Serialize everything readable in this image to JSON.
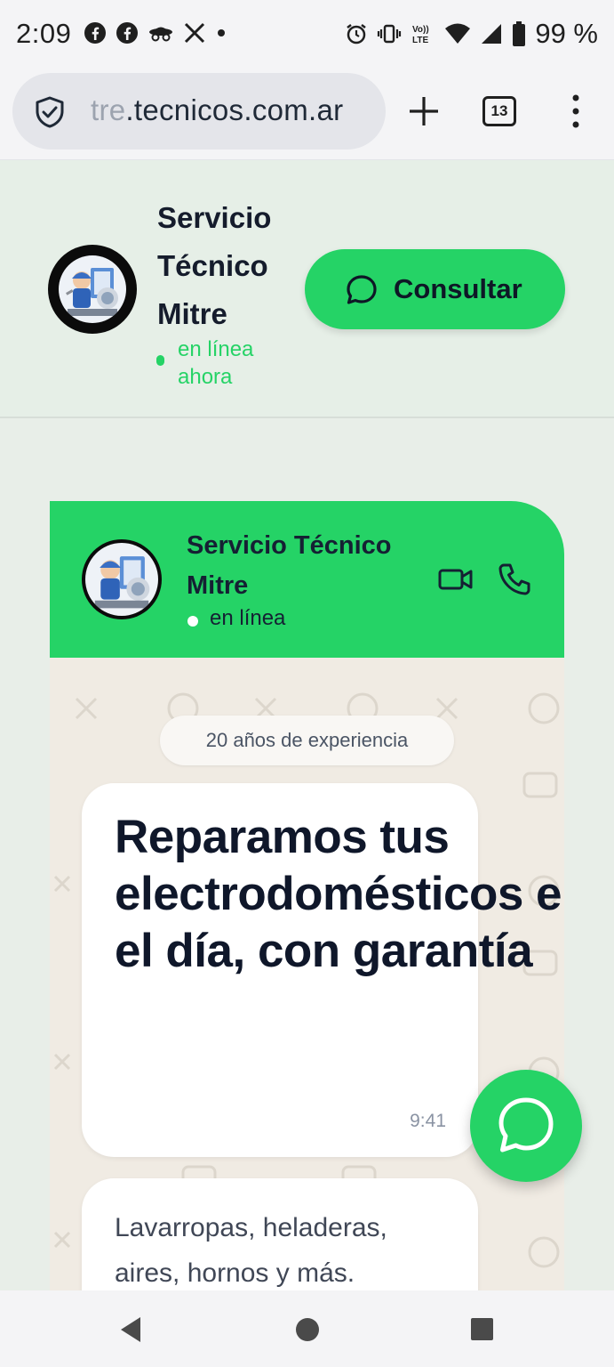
{
  "status_bar": {
    "time": "2:09",
    "battery_percent": "99 %",
    "icons_left": [
      "facebook-icon",
      "facebook-icon",
      "incognito-icon",
      "x-icon",
      "dot-icon"
    ],
    "icons_right": [
      "alarm-icon",
      "vibrate-icon",
      "volte-icon",
      "wifi-icon",
      "signal-icon",
      "battery-icon"
    ]
  },
  "browser": {
    "url_faded": "tre",
    "url_main": ".tecnicos.com.ar",
    "tab_count": "13"
  },
  "header": {
    "brand": "Servicio Técnico Mitre",
    "status": "en línea ahora",
    "cta": "Consultar"
  },
  "chat": {
    "name": "Servicio Técnico Mitre",
    "status": "en línea",
    "badge": "20 años de experiencia",
    "headline": "Reparamos tus electrodomésticos en el día, con garantía",
    "time": "9:41",
    "subtext": "Lavarropas, heladeras, aires, hornos y más."
  },
  "colors": {
    "accent": "#25d366",
    "page_bg": "#e6efe7",
    "chat_bg": "#f0ebe3"
  }
}
